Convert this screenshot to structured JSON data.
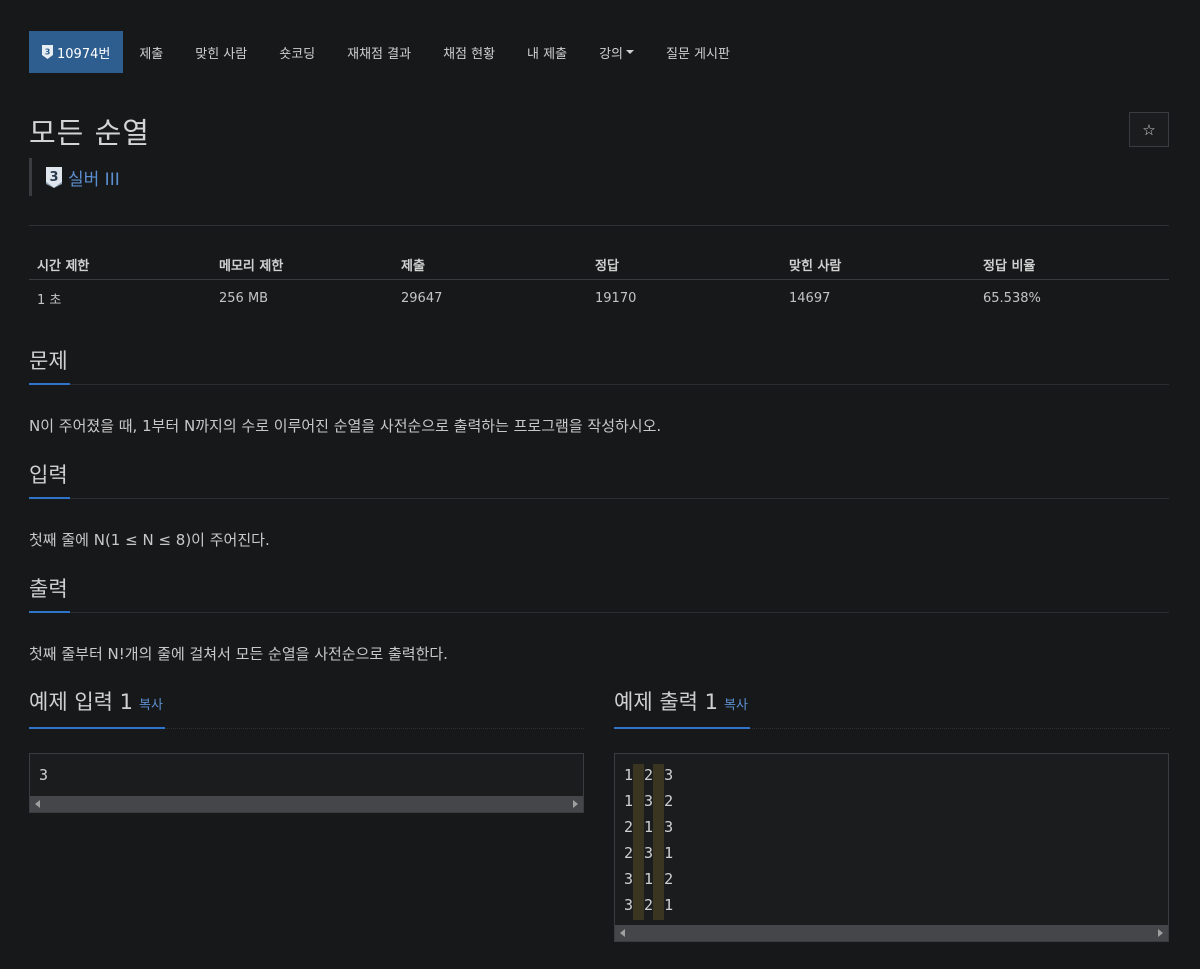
{
  "nav": {
    "problem_number": "10974번",
    "items": [
      "제출",
      "맞힌 사람",
      "숏코딩",
      "재채점 결과",
      "채점 현황",
      "내 제출",
      "강의",
      "질문 게시판"
    ]
  },
  "problem": {
    "title": "모든 순열",
    "star_icon": "☆",
    "tier_digit": "3",
    "tier_label": "실버 III"
  },
  "stats": {
    "headers": [
      "시간 제한",
      "메모리 제한",
      "제출",
      "정답",
      "맞힌 사람",
      "정답 비율"
    ],
    "values": [
      "1 초",
      "256 MB",
      "29647",
      "19170",
      "14697",
      "65.538%"
    ]
  },
  "sections": {
    "problem_title": "문제",
    "problem_text": "N이 주어졌을 때, 1부터 N까지의 수로 이루어진 순열을 사전순으로 출력하는 프로그램을 작성하시오.",
    "input_title": "입력",
    "input_text": "첫째 줄에 N(1 ≤ N ≤ 8)이 주어진다.",
    "output_title": "출력",
    "output_text": "첫째 줄부터 N!개의 줄에 걸쳐서 모든 순열을 사전순으로 출력한다."
  },
  "samples": {
    "input_title": "예제 입력 1",
    "output_title": "예제 출력 1",
    "copy_label": "복사",
    "input_lines": [
      "3"
    ],
    "output_lines": [
      [
        "1",
        "2",
        "3"
      ],
      [
        "1",
        "3",
        "2"
      ],
      [
        "2",
        "1",
        "3"
      ],
      [
        "2",
        "3",
        "1"
      ],
      [
        "3",
        "1",
        "2"
      ],
      [
        "3",
        "2",
        "1"
      ]
    ]
  },
  "colors": {
    "background": "#17181a",
    "nav_active": "#2e5e8f",
    "accent_blue": "#2e74c9",
    "tier_silver_text": "#5c8fd0",
    "space_highlight": "#3a3520"
  }
}
